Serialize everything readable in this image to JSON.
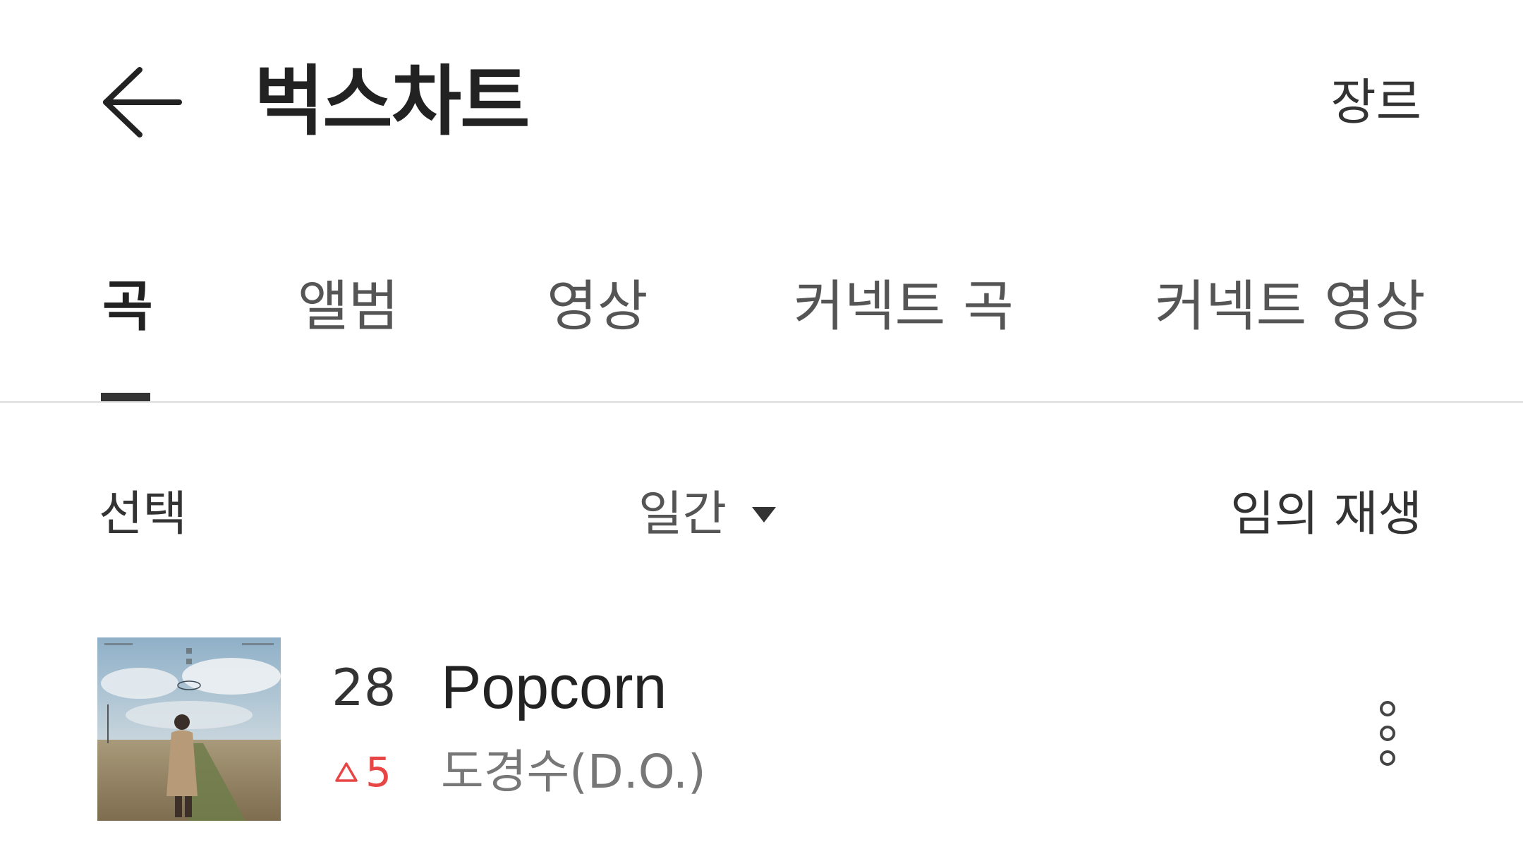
{
  "header": {
    "back_icon": "arrow-left-icon",
    "title": "벅스차트",
    "genre_label": "장르"
  },
  "tabs": [
    {
      "label": "곡",
      "active": true
    },
    {
      "label": "앨범",
      "active": false
    },
    {
      "label": "영상",
      "active": false
    },
    {
      "label": "커넥트 곡",
      "active": false
    },
    {
      "label": "커넥트 영상",
      "active": false
    }
  ],
  "controls": {
    "select_label": "선택",
    "period_label": "일간",
    "period_icon": "caret-down-icon",
    "shuffle_label": "임의 재생"
  },
  "songs": [
    {
      "rank": "28",
      "rank_change": "5",
      "rank_change_icon": "triangle-up-icon",
      "title": "Popcorn",
      "artist": "도경수(D.O.)",
      "more_icon": "more-vertical-icon"
    }
  ],
  "colors": {
    "accent_red": "#e84545",
    "tab_indicator": "#333333",
    "divider": "#dcdcdc"
  }
}
